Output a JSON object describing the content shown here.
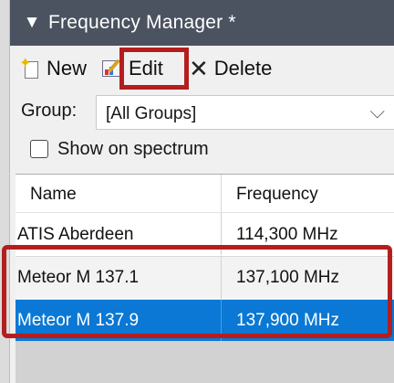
{
  "title": "Frequency Manager *",
  "toolbar": {
    "new_label": "New",
    "edit_label": "Edit",
    "delete_label": "Delete"
  },
  "group": {
    "label": "Group:",
    "selected": "[All Groups]"
  },
  "show_on_spectrum": {
    "label": "Show on spectrum",
    "checked": false
  },
  "list": {
    "columns": [
      "Name",
      "Frequency"
    ],
    "rows": [
      {
        "name": "ATIS Aberdeen",
        "frequency": "114,300 MHz",
        "selected": false
      },
      {
        "name": "Meteor M 137.1",
        "frequency": "137,100 MHz",
        "selected": false
      },
      {
        "name": "Meteor M 137.9",
        "frequency": "137,900 MHz",
        "selected": true
      }
    ]
  },
  "icons": {
    "title_collapse": "chevron-down-icon",
    "new": "new-document-icon",
    "edit": "edit-chart-icon",
    "delete": "x-delete-icon",
    "dropdown": "chevron-down-icon"
  },
  "colors": {
    "title_bar": "#4b5260",
    "selection": "#0a78d4",
    "highlight_border": "#b41e1e"
  }
}
